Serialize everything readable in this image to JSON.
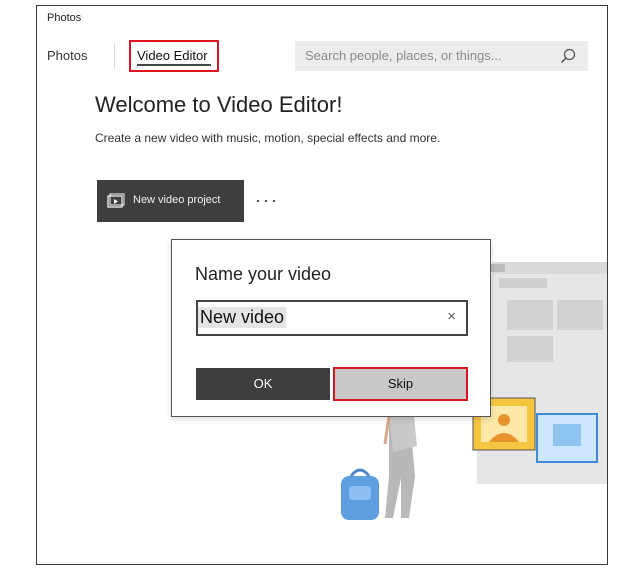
{
  "app": {
    "title": "Photos"
  },
  "nav": {
    "photos": "Photos",
    "video_editor": "Video Editor"
  },
  "search": {
    "placeholder": "Search people, places, or things..."
  },
  "main": {
    "welcome": "Welcome to Video Editor!",
    "subtitle": "Create a new video with music, motion, special effects and more.",
    "new_project": "New video project",
    "more": "···"
  },
  "dialog": {
    "title": "Name your video",
    "input_value": "New video",
    "clear": "×",
    "ok": "OK",
    "skip": "Skip"
  },
  "icons": [
    "search-icon",
    "video-project-icon",
    "close-icon",
    "backpack-illustration",
    "person-illustration",
    "photo-illustration"
  ],
  "colors": {
    "highlight": "#e0141e",
    "button_dark": "#3e3e3e"
  }
}
